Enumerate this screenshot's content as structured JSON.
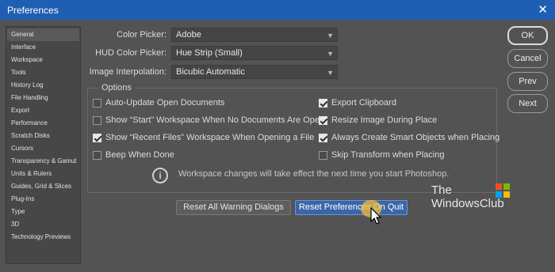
{
  "window": {
    "title": "Preferences",
    "close_glyph": "✕"
  },
  "sidebar": {
    "items": [
      {
        "label": "General"
      },
      {
        "label": "Interface"
      },
      {
        "label": "Workspace"
      },
      {
        "label": "Tools"
      },
      {
        "label": "History Log"
      },
      {
        "label": "File Handling"
      },
      {
        "label": "Export"
      },
      {
        "label": "Performance"
      },
      {
        "label": "Scratch Disks"
      },
      {
        "label": "Cursors"
      },
      {
        "label": "Transparency & Gamut"
      },
      {
        "label": "Units & Rulers"
      },
      {
        "label": "Guides, Grid & Slices"
      },
      {
        "label": "Plug-Ins"
      },
      {
        "label": "Type"
      },
      {
        "label": "3D"
      },
      {
        "label": "Technology Previews"
      }
    ],
    "selected": "General"
  },
  "fields": {
    "color_picker": {
      "label": "Color Picker:",
      "value": "Adobe"
    },
    "hud_color_picker": {
      "label": "HUD Color Picker:",
      "value": "Hue Strip (Small)"
    },
    "image_interpolation": {
      "label": "Image Interpolation:",
      "value": "Bicubic Automatic"
    }
  },
  "options": {
    "title": "Options",
    "left": [
      {
        "label": "Auto-Update Open Documents",
        "checked": false
      },
      {
        "label": "Show “Start” Workspace When No Documents Are Open",
        "checked": false
      },
      {
        "label": "Show “Recent Files” Workspace When Opening a File",
        "checked": true
      },
      {
        "label": "Beep When Done",
        "checked": false
      }
    ],
    "right": [
      {
        "label": "Export Clipboard",
        "checked": true
      },
      {
        "label": "Resize Image During Place",
        "checked": true
      },
      {
        "label": "Always Create Smart Objects when Placing",
        "checked": true
      },
      {
        "label": "Skip Transform when Placing",
        "checked": false
      }
    ],
    "info_text": "Workspace changes will take effect the next time you start Photoshop."
  },
  "buttons": {
    "reset_warnings": "Reset All Warning Dialogs",
    "reset_prefs": "Reset Preferences On Quit",
    "ok": "OK",
    "cancel": "Cancel",
    "prev": "Prev",
    "next": "Next"
  },
  "watermark": {
    "line1": "The",
    "line2": "WindowsClub"
  },
  "icons": {
    "close": "close-icon",
    "checkbox": "checkbox-icon",
    "chevron": "chevron-down-icon",
    "info": "info-icon",
    "cursor": "mouse-cursor-icon",
    "logo_flag": "windows-logo-icon"
  },
  "colors": {
    "titlebar": "#1f5fb3",
    "background": "#535353",
    "primary_button": "#3a66a8",
    "cursor_highlight": "#f0be3c"
  }
}
